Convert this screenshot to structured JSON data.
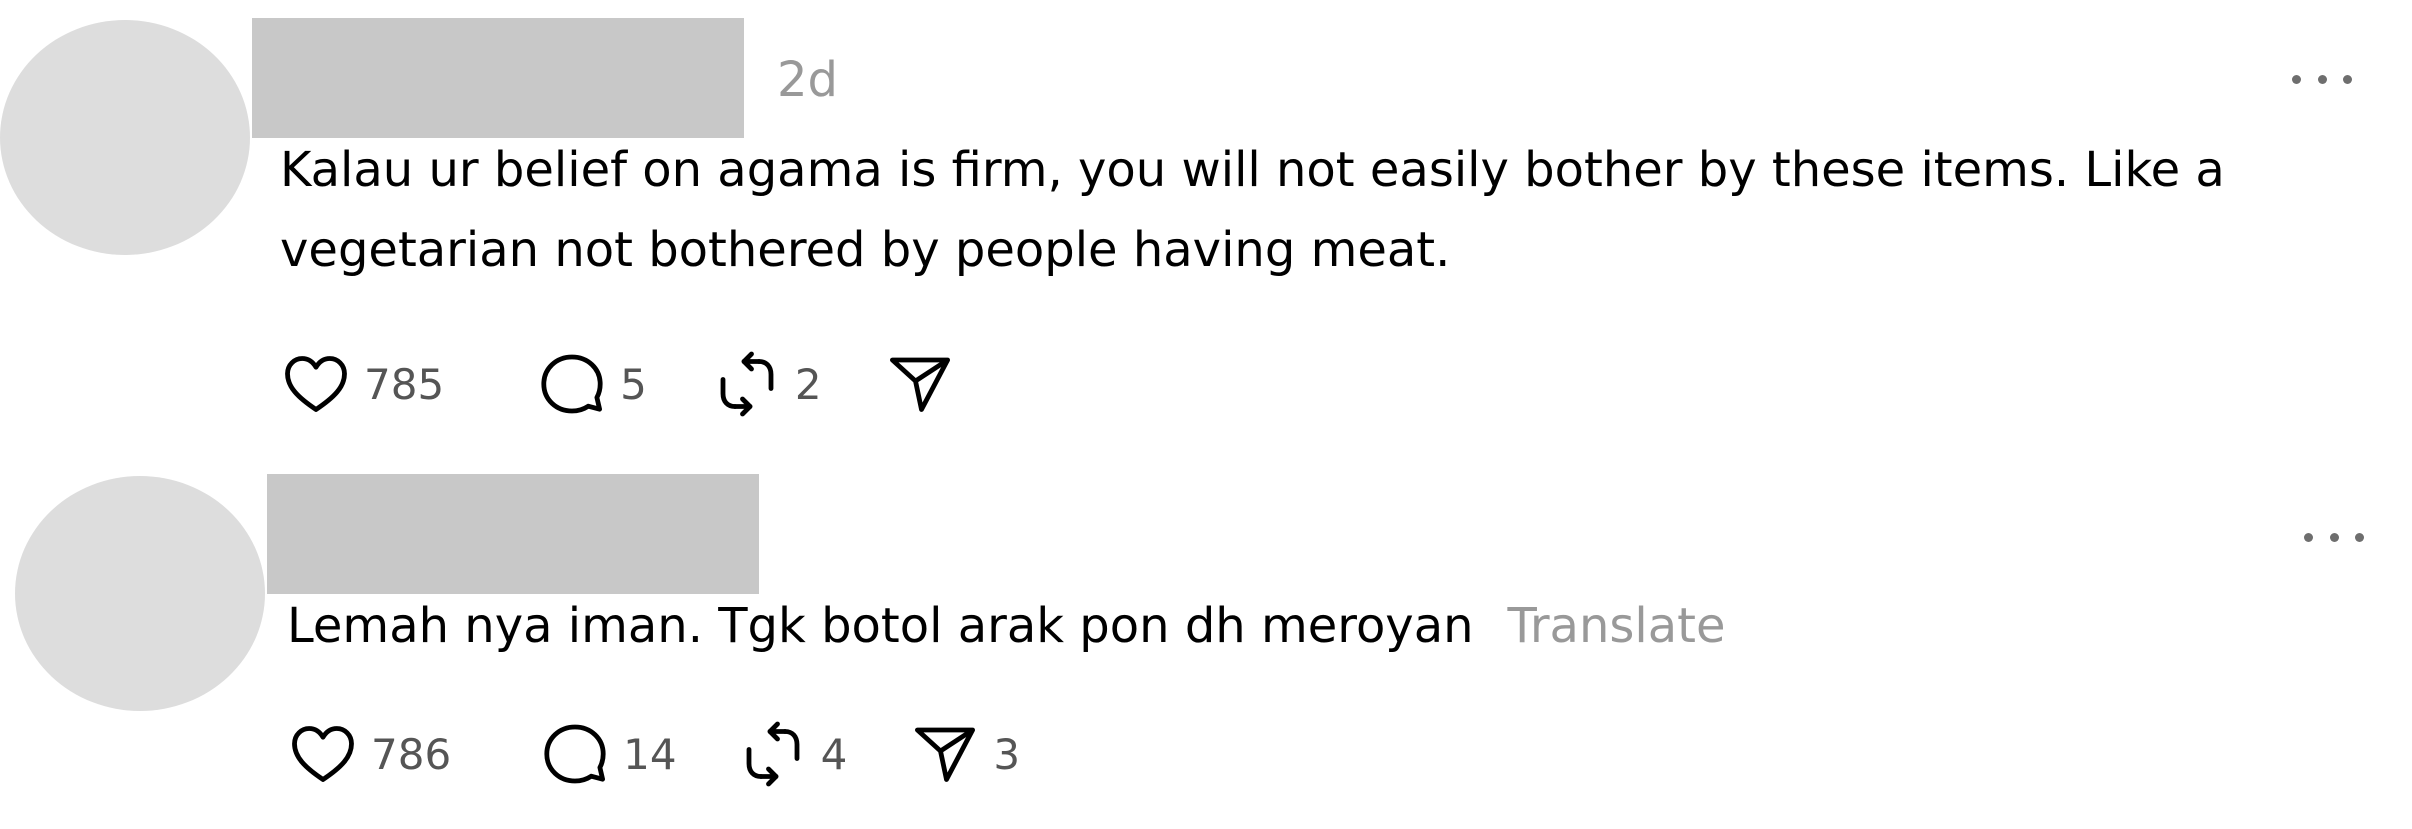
{
  "posts": [
    {
      "timestamp": "2d",
      "text": "Kalau ur belief on agama is firm, you will not easily bother by these items. Like a\nvegetarian not bothered by people having meat.",
      "translate_label": "",
      "likes": "785",
      "replies": "5",
      "reposts": "2",
      "shares": ""
    },
    {
      "timestamp": "",
      "text": "Lemah nya iman. Tgk botol arak pon dh meroyan",
      "translate_label": "Translate",
      "likes": "786",
      "replies": "14",
      "reposts": "4",
      "shares": "3"
    }
  ],
  "icons": {
    "like": "heart-icon",
    "reply": "speech-bubble-icon",
    "repost": "repost-arrows-icon",
    "share": "paper-plane-icon",
    "more": "ellipsis-icon"
  },
  "colors": {
    "text": "#000000",
    "muted": "#999999",
    "count": "#555555",
    "avatar_placeholder": "#dddddd",
    "name_placeholder": "#c8c8c8"
  }
}
